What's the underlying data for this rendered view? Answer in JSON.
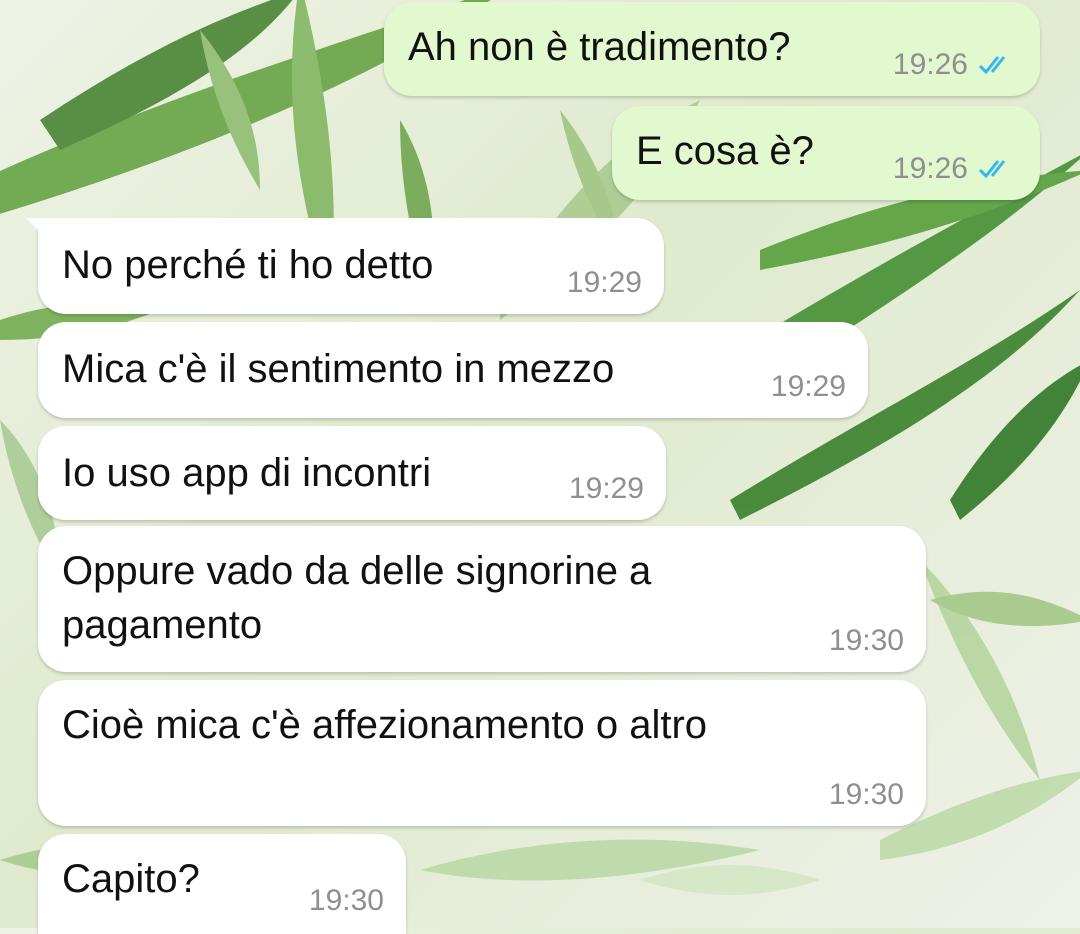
{
  "chat": {
    "messages": [
      {
        "direction": "out",
        "text": "Ah non è tradimento?",
        "time": "19:26",
        "status_icon": "double-check-blue-icon"
      },
      {
        "direction": "out",
        "text": "E cosa è?",
        "time": "19:26",
        "status_icon": "double-check-blue-icon"
      },
      {
        "direction": "in",
        "text": "No perché ti ho detto",
        "time": "19:29"
      },
      {
        "direction": "in",
        "text": "Mica c'è il sentimento in mezzo",
        "time": "19:29"
      },
      {
        "direction": "in",
        "text": "Io uso app di incontri",
        "time": "19:29"
      },
      {
        "direction": "in",
        "text": "Oppure vado da delle signorine a\npagamento",
        "time": "19:30"
      },
      {
        "direction": "in",
        "text": "Cioè mica c'è affezionamento o altro",
        "time": "19:30"
      },
      {
        "direction": "in",
        "text": "Capito?",
        "time": "19:30"
      }
    ]
  },
  "colors": {
    "incoming_bubble": "#ffffff",
    "outgoing_bubble": "#e2f8cf",
    "read_ticks": "#34b7f1",
    "timestamp": "#8f8f8f"
  }
}
